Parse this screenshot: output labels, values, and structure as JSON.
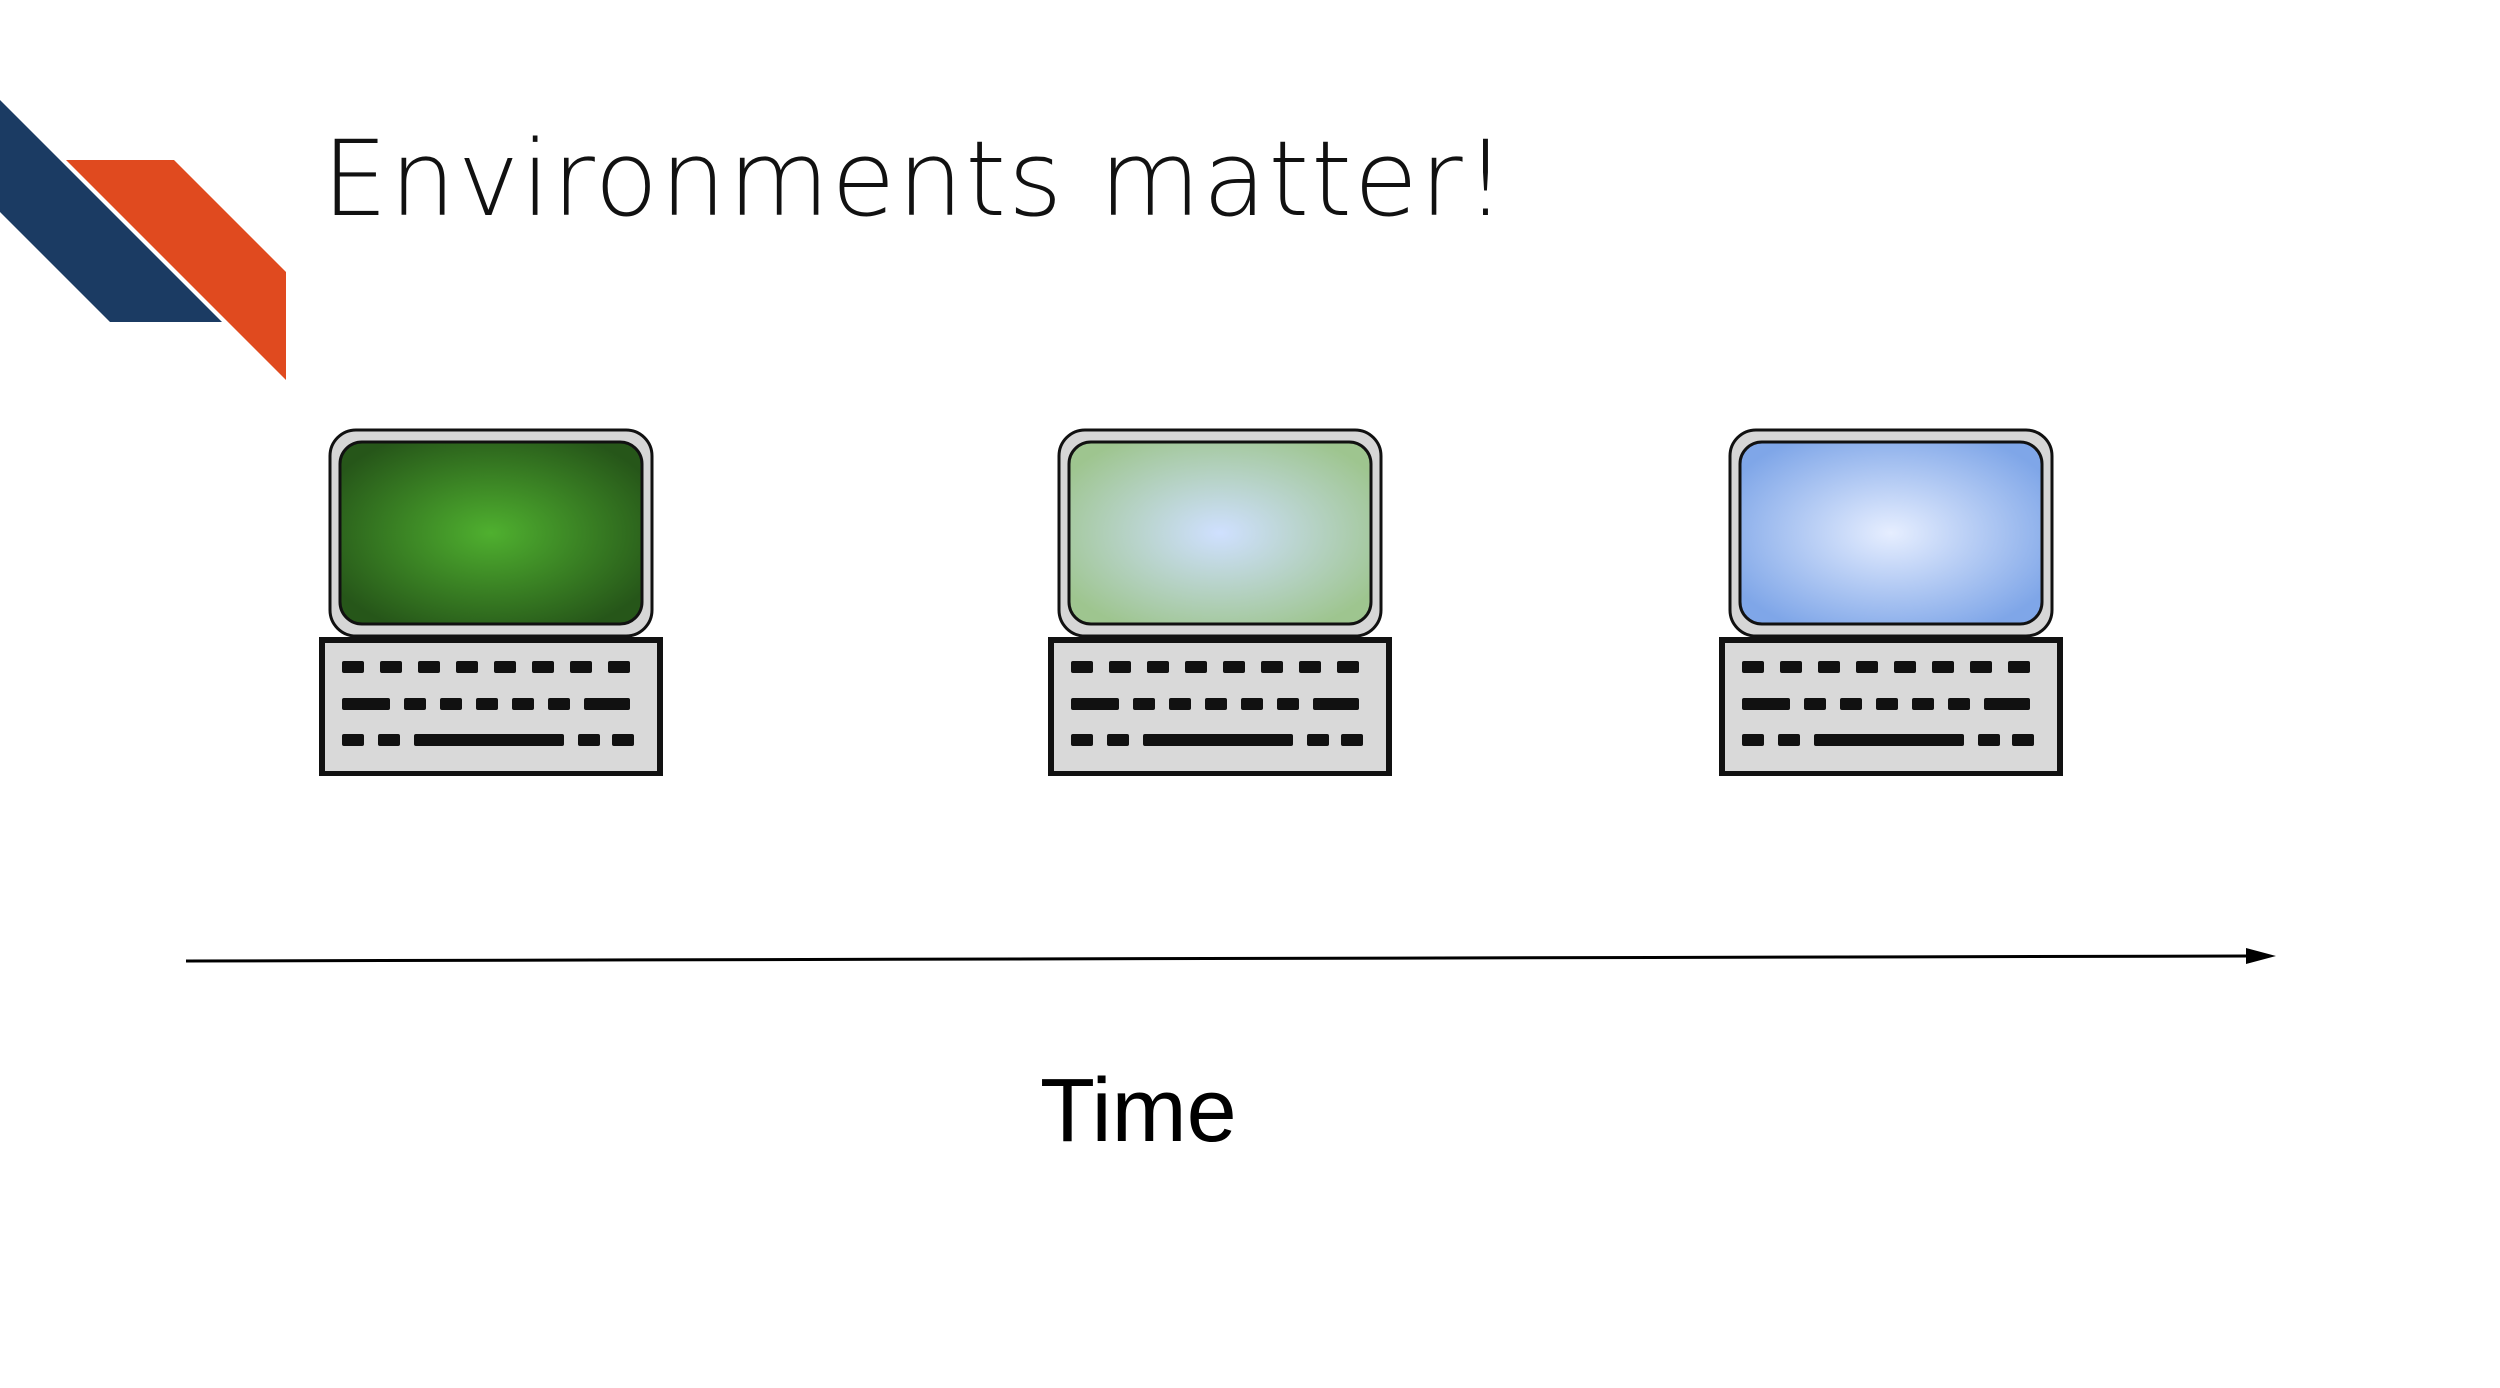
{
  "slide": {
    "title": "Environments matter!",
    "time_label": "Time"
  },
  "computers": [
    {
      "name": "green-screen-computer",
      "screen_center": "#4fb02f",
      "screen_edge": "#265619"
    },
    {
      "name": "pale-green-screen-computer",
      "screen_center": "#cfe0ff",
      "screen_edge": "#9ec58f"
    },
    {
      "name": "blue-screen-computer",
      "screen_center": "#e6eeff",
      "screen_edge": "#7fa6e8"
    }
  ],
  "colors": {
    "logo_navy": "#1b3b63",
    "logo_orange": "#e04a1f",
    "arrow": "#000000"
  }
}
